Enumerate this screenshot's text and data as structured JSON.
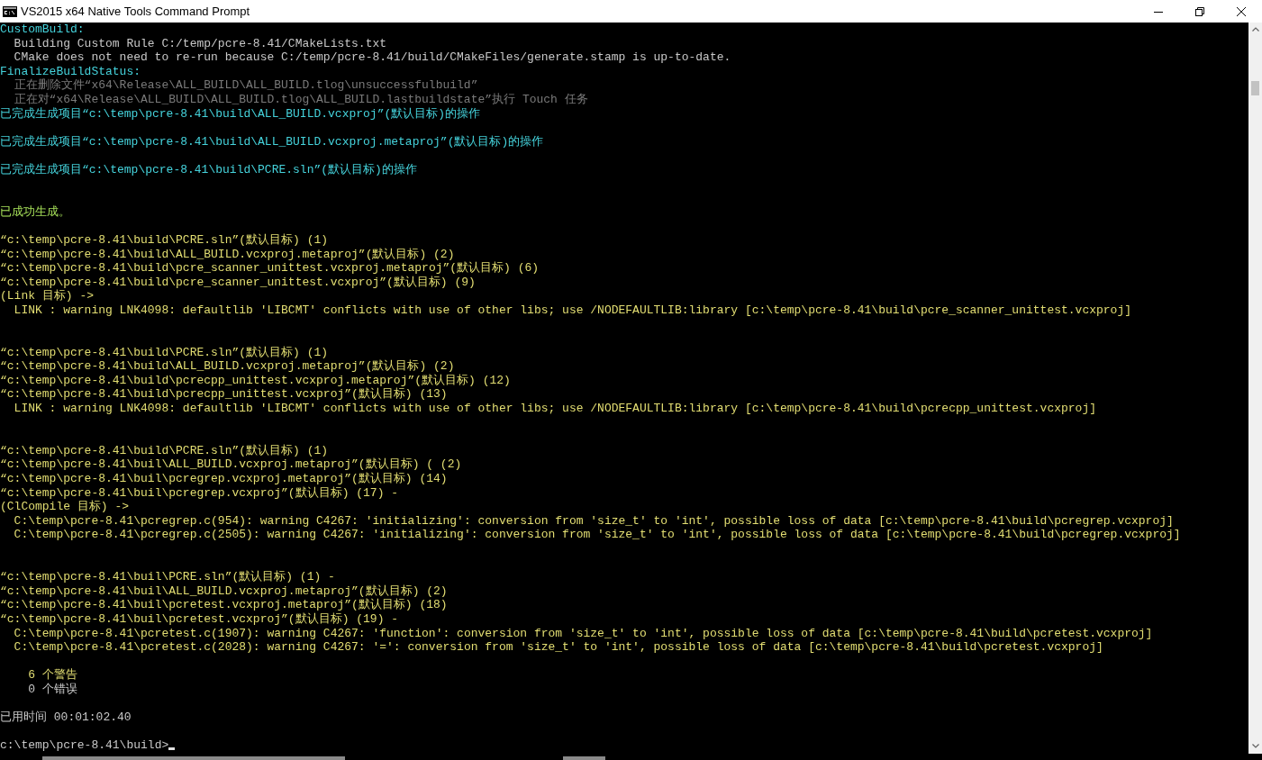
{
  "window": {
    "title": "VS2015 x64 Native Tools Command Prompt"
  },
  "console": {
    "lines": [
      {
        "kind": "heading",
        "text": "CustomBuild:"
      },
      {
        "kind": "info",
        "text": "  Building Custom Rule C:/temp/pcre-8.41/CMakeLists.txt"
      },
      {
        "kind": "info",
        "text": "  CMake does not need to re-run because C:/temp/pcre-8.41/build/CMakeFiles/generate.stamp is up-to-date."
      },
      {
        "kind": "heading",
        "text": "FinalizeBuildStatus:"
      },
      {
        "kind": "muted",
        "text": "  正在删除文件“x64\\Release\\ALL_BUILD\\ALL_BUILD.tlog\\unsuccessfulbuild”"
      },
      {
        "kind": "muted",
        "text": "  正在对“x64\\Release\\ALL_BUILD\\ALL_BUILD.tlog\\ALL_BUILD.lastbuildstate”执行 Touch 任务"
      },
      {
        "kind": "heading",
        "text": "已完成生成项目“c:\\temp\\pcre-8.41\\build\\ALL_BUILD.vcxproj”(默认目标)的操作"
      },
      {
        "kind": "blank"
      },
      {
        "kind": "heading",
        "text": "已完成生成项目“c:\\temp\\pcre-8.41\\build\\ALL_BUILD.vcxproj.metaproj”(默认目标)的操作"
      },
      {
        "kind": "blank"
      },
      {
        "kind": "heading",
        "text": "已完成生成项目“c:\\temp\\pcre-8.41\\build\\PCRE.sln”(默认目标)的操作"
      },
      {
        "kind": "blank"
      },
      {
        "kind": "blank"
      },
      {
        "kind": "success",
        "text": "已成功生成。"
      },
      {
        "kind": "blank"
      },
      {
        "kind": "warning",
        "text": "“c:\\temp\\pcre-8.41\\build\\PCRE.sln”(默认目标) (1)"
      },
      {
        "kind": "warning",
        "text": "“c:\\temp\\pcre-8.41\\build\\ALL_BUILD.vcxproj.metaproj”(默认目标) (2)"
      },
      {
        "kind": "warning",
        "text": "“c:\\temp\\pcre-8.41\\build\\pcre_scanner_unittest.vcxproj.metaproj”(默认目标) (6)"
      },
      {
        "kind": "warning",
        "text": "“c:\\temp\\pcre-8.41\\build\\pcre_scanner_unittest.vcxproj”(默认目标) (9)"
      },
      {
        "kind": "warning",
        "text": "(Link 目标) ->"
      },
      {
        "kind": "warning",
        "text": "  LINK : warning LNK4098: defaultlib 'LIBCMT' conflicts with use of other libs; use /NODEFAULTLIB:library [c:\\temp\\pcre-8.41\\build\\pcre_scanner_unittest.vcxproj]"
      },
      {
        "kind": "blank"
      },
      {
        "kind": "blank"
      },
      {
        "kind": "warning",
        "text": "“c:\\temp\\pcre-8.41\\build\\PCRE.sln”(默认目标) (1)"
      },
      {
        "kind": "warning",
        "text": "“c:\\temp\\pcre-8.41\\build\\ALL_BUILD.vcxproj.metaproj”(默认目标) (2)"
      },
      {
        "kind": "warning",
        "text": "“c:\\temp\\pcre-8.41\\build\\pcrecpp_unittest.vcxproj.metaproj”(默认目标) (12)"
      },
      {
        "kind": "warning",
        "text": "“c:\\temp\\pcre-8.41\\build\\pcrecpp_unittest.vcxproj”(默认目标) (13)"
      },
      {
        "kind": "warning",
        "text": "  LINK : warning LNK4098: defaultlib 'LIBCMT' conflicts with use of other libs; use /NODEFAULTLIB:library [c:\\temp\\pcre-8.41\\build\\pcrecpp_unittest.vcxproj]"
      },
      {
        "kind": "blank"
      },
      {
        "kind": "blank"
      },
      {
        "kind": "warning",
        "text": "“c:\\temp\\pcre-8.41\\build\\PCRE.sln”(默认目标) (1)"
      },
      {
        "kind": "warning",
        "text": "“c:\\temp\\pcre-8.41\\buil\\ALL_BUILD.vcxproj.metaproj”(默认目标) ( (2)"
      },
      {
        "kind": "warning",
        "text": "“c:\\temp\\pcre-8.41\\buil\\pcregrep.vcxproj.metaproj”(默认目标) (14)"
      },
      {
        "kind": "warning",
        "text": "“c:\\temp\\pcre-8.41\\buil\\pcregrep.vcxproj”(默认目标) (17) -"
      },
      {
        "kind": "warning",
        "text": "(ClCompile 目标) ->"
      },
      {
        "kind": "warning",
        "text": "  C:\\temp\\pcre-8.41\\pcregrep.c(954): warning C4267: 'initializing': conversion from 'size_t' to 'int', possible loss of data [c:\\temp\\pcre-8.41\\build\\pcregrep.vcxproj]"
      },
      {
        "kind": "warning",
        "text": "  C:\\temp\\pcre-8.41\\pcregrep.c(2505): warning C4267: 'initializing': conversion from 'size_t' to 'int', possible loss of data [c:\\temp\\pcre-8.41\\build\\pcregrep.vcxproj]"
      },
      {
        "kind": "blank"
      },
      {
        "kind": "blank"
      },
      {
        "kind": "warning",
        "text": "“c:\\temp\\pcre-8.41\\buil\\PCRE.sln”(默认目标) (1) -"
      },
      {
        "kind": "warning",
        "text": "“c:\\temp\\pcre-8.41\\buil\\ALL_BUILD.vcxproj.metaproj”(默认目标) (2)"
      },
      {
        "kind": "warning",
        "text": "“c:\\temp\\pcre-8.41\\buil\\pcretest.vcxproj.metaproj”(默认目标) (18)"
      },
      {
        "kind": "warning",
        "text": "“c:\\temp\\pcre-8.41\\buil\\pcretest.vcxproj”(默认目标) (19) -"
      },
      {
        "kind": "warning",
        "text": "  C:\\temp\\pcre-8.41\\pcretest.c(1907): warning C4267: 'function': conversion from 'size_t' to 'int', possible loss of data [c:\\temp\\pcre-8.41\\build\\pcretest.vcxproj]"
      },
      {
        "kind": "warning",
        "text": "  C:\\temp\\pcre-8.41\\pcretest.c(2028): warning C4267: '=': conversion from 'size_t' to 'int', possible loss of data [c:\\temp\\pcre-8.41\\build\\pcretest.vcxproj]"
      },
      {
        "kind": "blank"
      },
      {
        "kind": "warning",
        "text": "    6 个警告"
      },
      {
        "kind": "info",
        "text": "    0 个错误"
      },
      {
        "kind": "blank"
      },
      {
        "kind": "info",
        "text": "已用时间 00:01:02.40"
      },
      {
        "kind": "blank"
      },
      {
        "kind": "prompt",
        "text": "c:\\temp\\pcre-8.41\\build>",
        "cursor": true
      }
    ]
  }
}
